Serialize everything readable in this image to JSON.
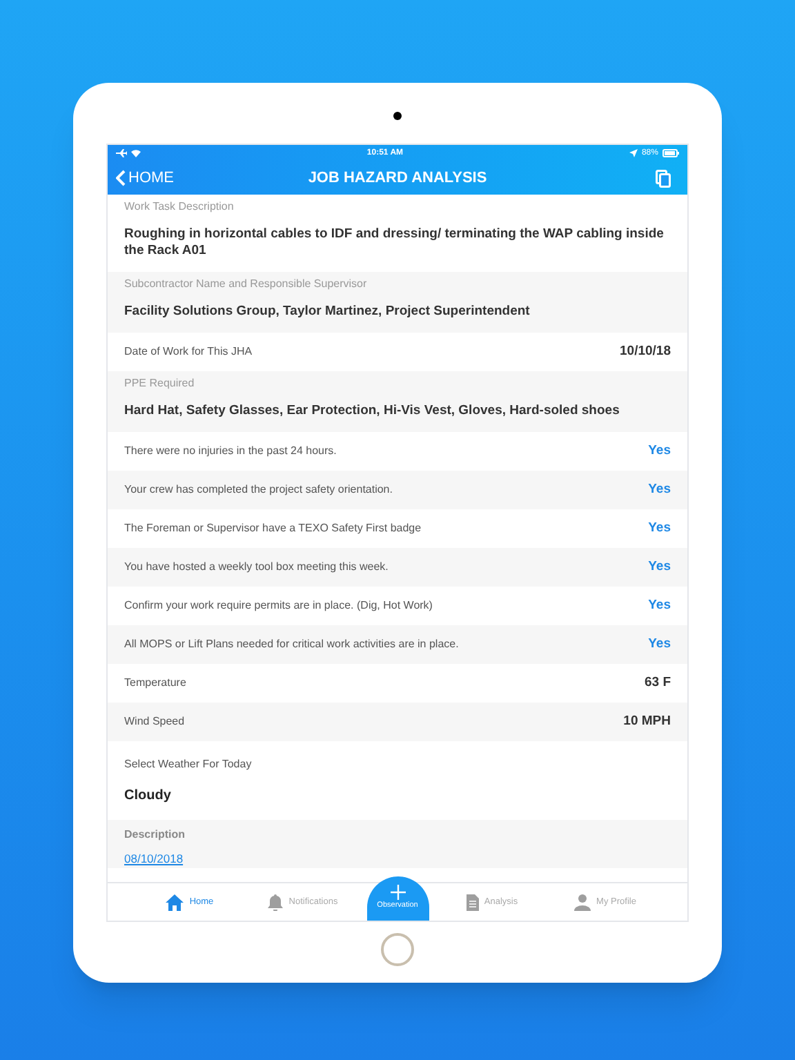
{
  "status_bar": {
    "time": "10:51 AM",
    "battery": "88%"
  },
  "nav_bar": {
    "back": "HOME",
    "title": "JOB HAZARD ANALYSIS"
  },
  "fields": [
    {
      "kind": "stacked",
      "label": "Work Task Description",
      "value": "Roughing in horizontal cables to IDF and dressing/ terminating the WAP cabling inside the Rack A01"
    },
    {
      "kind": "stacked",
      "label": "Subcontractor Name and Responsible Supervisor",
      "value": "Facility Solutions Group, Taylor Martinez, Project Superintendent"
    },
    {
      "kind": "inline",
      "label": "Date of Work for This JHA",
      "value": "10/10/18"
    },
    {
      "kind": "stacked",
      "label": "PPE Required",
      "value": "Hard Hat, Safety Glasses, Ear Protection, Hi-Vis Vest, Gloves, Hard-soled shoes"
    },
    {
      "kind": "answer",
      "label": "There were no injuries in the past 24 hours.",
      "value": "Yes"
    },
    {
      "kind": "answer",
      "label": "Your crew has completed the project safety orientation.",
      "value": "Yes"
    },
    {
      "kind": "answer",
      "label": "The Foreman or Supervisor have a TEXO Safety First badge",
      "value": "Yes"
    },
    {
      "kind": "answer",
      "label": "You have hosted a weekly tool box meeting this week.",
      "value": "Yes"
    },
    {
      "kind": "answer",
      "label": "Confirm your work require permits are in place. (Dig, Hot Work)",
      "value": "Yes"
    },
    {
      "kind": "answer",
      "label": "All MOPS or Lift Plans needed for critical work activities are in place.",
      "value": "Yes"
    },
    {
      "kind": "inline",
      "label": "Temperature",
      "value": "63 F"
    },
    {
      "kind": "inline",
      "label": "Wind Speed",
      "value": "10 MPH"
    },
    {
      "kind": "weather",
      "label": "Select Weather For Today",
      "value": "Cloudy"
    },
    {
      "kind": "link",
      "label": "Description",
      "value": "08/10/2018"
    }
  ],
  "tab_bar": [
    {
      "kind": "home",
      "label": "Home",
      "selected": true
    },
    {
      "kind": "bell",
      "label": "Notifications",
      "selected": false
    },
    {
      "kind": "fab",
      "label": "Observation",
      "selected": false
    },
    {
      "kind": "doc",
      "label": "Analysis",
      "selected": false
    },
    {
      "kind": "person",
      "label": "My Profile",
      "selected": false
    }
  ]
}
